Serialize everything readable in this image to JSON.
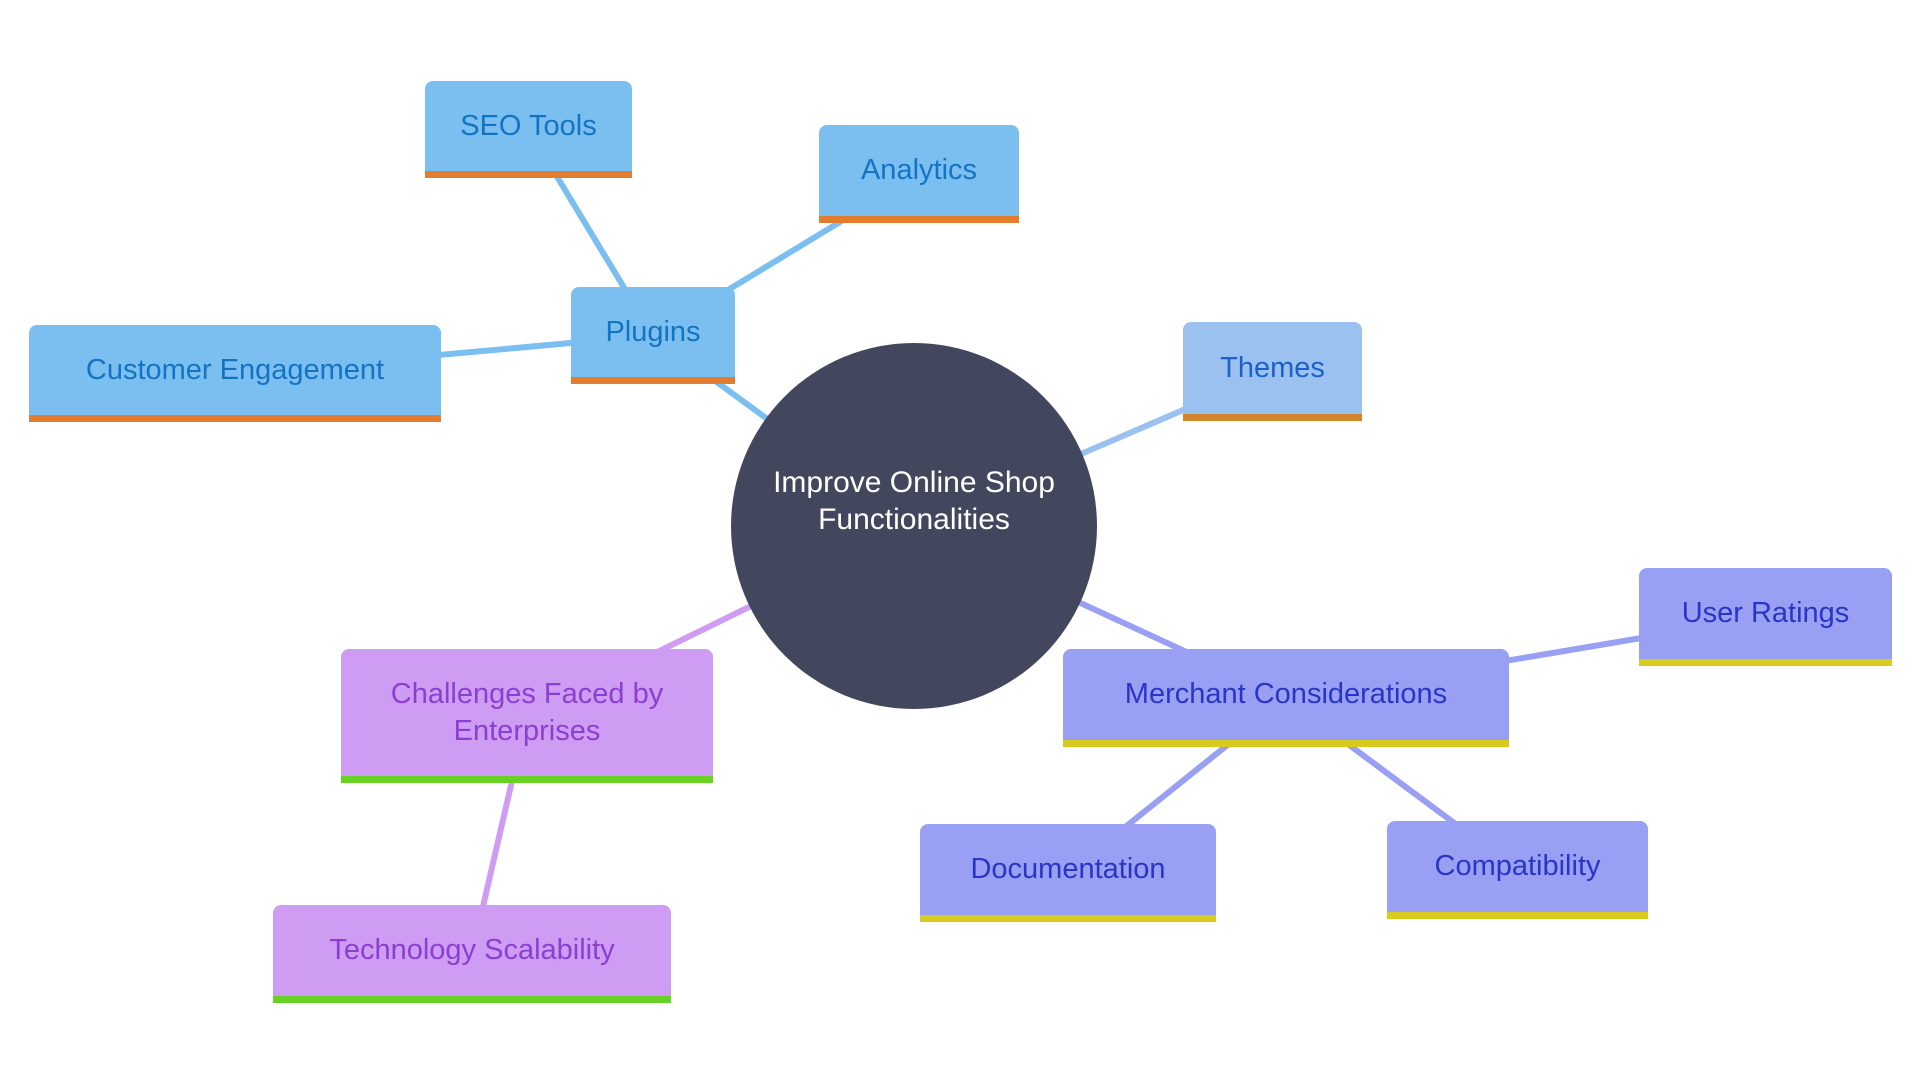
{
  "diagram": {
    "type": "mindmap",
    "root": {
      "id": "root",
      "label": "Improve Online Shop Functionalities",
      "fill": "#42475e",
      "text_color": "#ffffff"
    },
    "styles": {
      "plugins": {
        "fill": "#7bbff0",
        "text": "#1473c3",
        "bar": "#e27c2f",
        "edge": "#7bbff0"
      },
      "themes": {
        "fill": "#9ac1ef",
        "text": "#1b62c4",
        "bar": "#d4842a",
        "edge": "#9ac1ef"
      },
      "merchant": {
        "fill": "#999ff2",
        "text": "#2a35c6",
        "bar": "#d8cb20",
        "edge": "#999ff2"
      },
      "challenges": {
        "fill": "#cf9cf3",
        "text": "#8b3fd2",
        "bar": "#67d126",
        "edge": "#cf9cf3"
      }
    },
    "nodes": {
      "plugins": {
        "label": "Plugins",
        "style": "plugins"
      },
      "seo": {
        "label": "SEO Tools",
        "style": "plugins"
      },
      "analytics": {
        "label": "Analytics",
        "style": "plugins"
      },
      "customer": {
        "label": "Customer Engagement",
        "style": "plugins"
      },
      "themes": {
        "label": "Themes",
        "style": "themes"
      },
      "merchant": {
        "label": "Merchant Considerations",
        "style": "merchant"
      },
      "ratings": {
        "label": "User Ratings",
        "style": "merchant"
      },
      "docs": {
        "label": "Documentation",
        "style": "merchant"
      },
      "compat": {
        "label": "Compatibility",
        "style": "merchant"
      },
      "challenges": {
        "label": "Challenges Faced by Enterprises",
        "style": "challenges"
      },
      "tech": {
        "label": "Technology Scalability",
        "style": "challenges"
      }
    },
    "edges": [
      {
        "from": "root",
        "to": "plugins"
      },
      {
        "from": "plugins",
        "to": "seo"
      },
      {
        "from": "plugins",
        "to": "analytics"
      },
      {
        "from": "plugins",
        "to": "customer"
      },
      {
        "from": "root",
        "to": "themes"
      },
      {
        "from": "root",
        "to": "merchant"
      },
      {
        "from": "merchant",
        "to": "ratings"
      },
      {
        "from": "merchant",
        "to": "docs"
      },
      {
        "from": "merchant",
        "to": "compat"
      },
      {
        "from": "root",
        "to": "challenges"
      },
      {
        "from": "challenges",
        "to": "tech"
      }
    ]
  }
}
